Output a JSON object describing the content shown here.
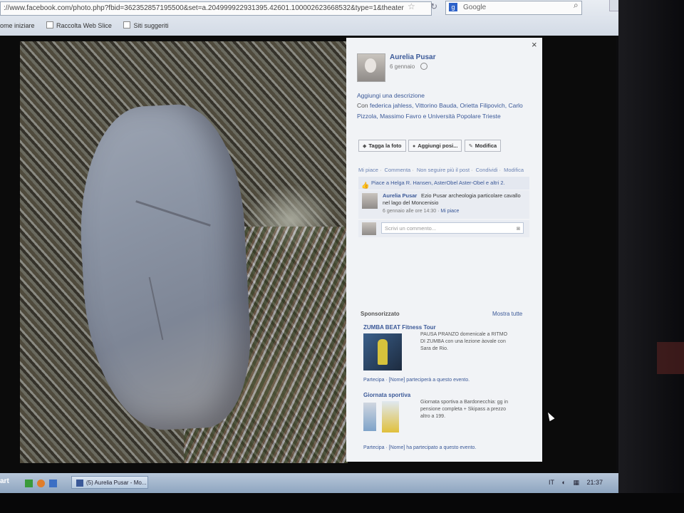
{
  "browser": {
    "url": "://www.facebook.com/photo.php?fbid=362352857195500&set=a.204999922931395.42601.100002623668532&type=1&theater",
    "search_label": "Google",
    "search_engine_icon": "g",
    "bookmarks": [
      "ome iniziare",
      "Raccolta Web Slice",
      "Siti suggeriti"
    ]
  },
  "panel": {
    "close": "×",
    "author": "Aurelia Pusar",
    "date": "6 gennaio",
    "add_description": "Aggiungi una descrizione",
    "with_prefix": "Con",
    "with_names": "federica jahless, Vittorino Bauda, Orietta Filipovich, Carlo Pizzola, Massimo Favro e Università Popolare Trieste",
    "buttons": {
      "tag": "Tagga la foto",
      "place": "Aggiungi posi...",
      "edit": "Modifica"
    },
    "actions": [
      "Mi piace",
      "Commenta",
      "Non seguire più il post",
      "Condividi",
      "Modifica"
    ],
    "likes": "Piace a Helga R. Hansen, AsterObel Aster-Obel e altri 2.",
    "comment": {
      "author": "Aurelia Pusar",
      "text": "Ezio Pusar archeologia particolare cavallo nel lago del Moncenisio",
      "time": "6 gennaio alle ore 14:30",
      "like": "Mi piace"
    },
    "write_placeholder": "Scrivi un commento..."
  },
  "sponsored": {
    "title": "Sponsorizzato",
    "show_all": "Mostra tutte",
    "ads": [
      {
        "title": "ZUMBA BEAT Fitness Tour",
        "text": "PAUSA PRANZO domenicale a RITMO DI ZUMBA con una lezione àovale con Sara de Rio.",
        "share": "Partecipa · [Nome] parteciperà a questo evento."
      },
      {
        "title": "Giornata sportiva",
        "text": "Giornata sportiva a Bardonecchia: gg in pensione completa + Skipass a prezzo altro a 199.",
        "share": "Partecipa · [Nome] ha partecipato a questo evento."
      }
    ]
  },
  "taskbar": {
    "start": "art",
    "task": "(5) Aurelia Pusar - Mo...",
    "tray": [
      "IT",
      "21:37"
    ]
  }
}
